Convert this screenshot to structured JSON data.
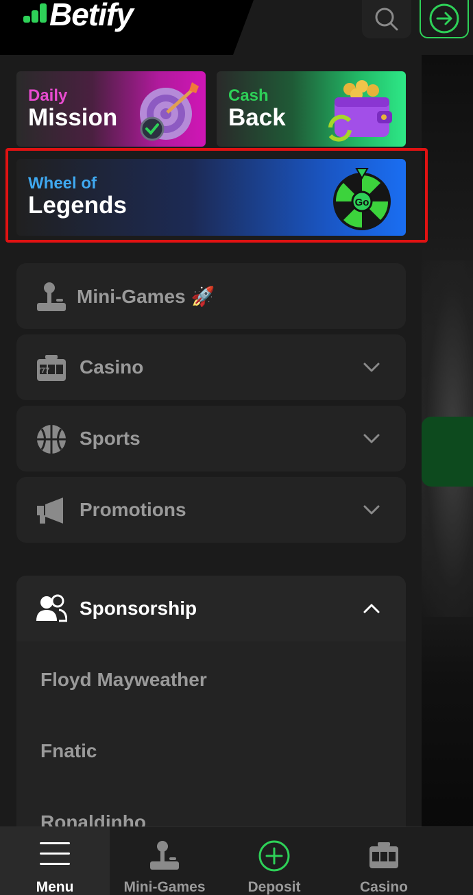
{
  "brand": {
    "name": "Betify",
    "accent": "#2ed158"
  },
  "header": {
    "search_icon": "search-icon",
    "login_icon": "arrow-right-circle-icon"
  },
  "promos": {
    "daily": {
      "line1": "Daily",
      "line2": "Mission",
      "accent": "#e84bd0"
    },
    "cash": {
      "line1": "Cash",
      "line2": "Back",
      "accent": "#2ed158"
    },
    "wheel": {
      "line1": "Wheel of",
      "line2": "Legends",
      "accent": "#3fa8ef",
      "badge": "Go",
      "highlight_color": "#e01212"
    }
  },
  "menu": {
    "items": [
      {
        "label": "Mini-Games 🚀",
        "icon": "joystick-icon"
      },
      {
        "label": "Casino",
        "icon": "slot-machine-icon"
      },
      {
        "label": "Sports",
        "icon": "basketball-icon"
      },
      {
        "label": "Promotions",
        "icon": "megaphone-icon"
      }
    ],
    "sponsorship": {
      "label": "Sponsorship",
      "icon": "users-icon",
      "items": [
        "Floyd Mayweather",
        "Fnatic",
        "Ronaldinho"
      ]
    }
  },
  "bottom_nav": {
    "menu": "Menu",
    "mini_games": "Mini-Games",
    "deposit": "Deposit",
    "casino": "Casino",
    "slot_label": "777"
  }
}
